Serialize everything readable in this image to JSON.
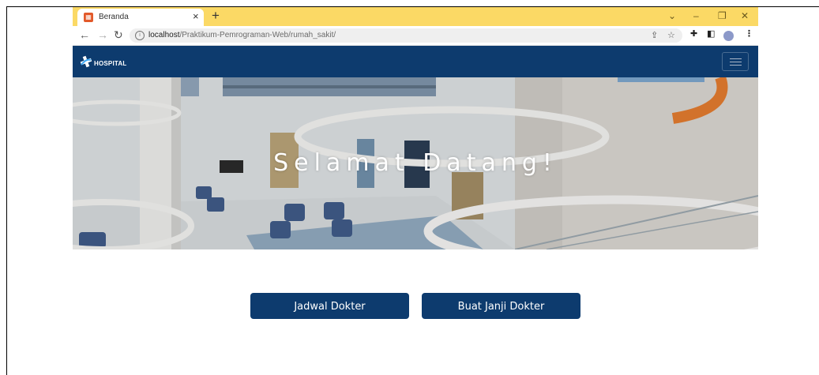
{
  "browser": {
    "tab": {
      "title": "Beranda",
      "favicon": "page-favicon-icon"
    },
    "address": {
      "host": "localhost",
      "path": "/Praktikum-Pemrograman-Web/rumah_sakit/"
    }
  },
  "site": {
    "brand": {
      "text": "HOSPITAL",
      "icon": "medical-cross-icon"
    },
    "hero": {
      "title": "Selamat Datang!"
    },
    "actions": [
      {
        "label": "Jadwal Dokter"
      },
      {
        "label": "Buat Janji Dokter"
      }
    ]
  },
  "colors": {
    "navbar": "#0d3b6e",
    "button": "#0d3b6e",
    "tabstrip": "#fbd965",
    "hero_accent": "#e07a2e"
  }
}
